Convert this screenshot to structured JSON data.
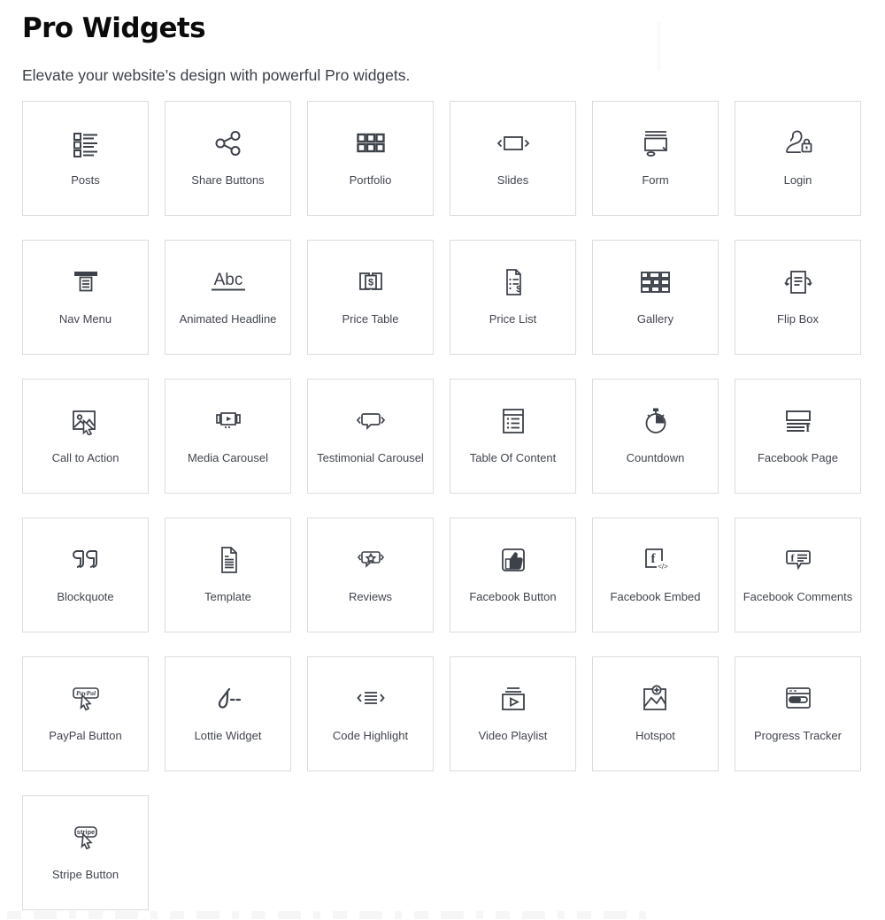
{
  "header": {
    "title": "Pro Widgets",
    "subtitle": "Elevate your website’s design with powerful Pro widgets."
  },
  "colors": {
    "title": "#0b0b0b",
    "subtitle": "#3b3f47",
    "card_border": "#dcdcde",
    "card_bg": "#ffffff",
    "label": "#41454e",
    "icon_stroke": "#3d4149",
    "page_bg": "#ffffff"
  },
  "grid": {
    "columns": 6,
    "rows": 6,
    "total_widgets": 31,
    "widgets": [
      {
        "label": "Posts",
        "icon": "posts-list-icon"
      },
      {
        "label": "Share Buttons",
        "icon": "share-network-icon"
      },
      {
        "label": "Portfolio",
        "icon": "grid-squares-icon"
      },
      {
        "label": "Slides",
        "icon": "slides-arrows-icon"
      },
      {
        "label": "Form",
        "icon": "form-monitor-icon"
      },
      {
        "label": "Login",
        "icon": "user-lock-icon"
      },
      {
        "label": "Nav Menu",
        "icon": "nav-menu-icon"
      },
      {
        "label": "Animated Headline",
        "icon": "abc-underline-icon"
      },
      {
        "label": "Price Table",
        "icon": "price-table-dollar-icon"
      },
      {
        "label": "Price List",
        "icon": "price-list-document-icon"
      },
      {
        "label": "Gallery",
        "icon": "gallery-bricks-icon"
      },
      {
        "label": "Flip Box",
        "icon": "flip-box-icon"
      },
      {
        "label": "Call to Action",
        "icon": "image-cursor-icon"
      },
      {
        "label": "Media Carousel",
        "icon": "media-carousel-icon"
      },
      {
        "label": "Testimonial Carousel",
        "icon": "speech-bubble-arrows-icon"
      },
      {
        "label": "Table Of Content",
        "icon": "table-of-content-icon"
      },
      {
        "label": "Countdown",
        "icon": "stopwatch-icon"
      },
      {
        "label": "Facebook Page",
        "icon": "facebook-page-icon"
      },
      {
        "label": "Blockquote",
        "icon": "quote-marks-icon"
      },
      {
        "label": "Template",
        "icon": "template-document-icon"
      },
      {
        "label": "Reviews",
        "icon": "review-star-bubble-icon"
      },
      {
        "label": "Facebook Button",
        "icon": "thumbs-up-icon"
      },
      {
        "label": "Facebook Embed",
        "icon": "facebook-code-icon"
      },
      {
        "label": "Facebook Comments",
        "icon": "facebook-comment-bubble-icon"
      },
      {
        "label": "PayPal Button",
        "icon": "paypal-button-cursor-icon"
      },
      {
        "label": "Lottie Widget",
        "icon": "lottie-icon"
      },
      {
        "label": "Code Highlight",
        "icon": "code-lines-icon"
      },
      {
        "label": "Video Playlist",
        "icon": "video-playlist-icon"
      },
      {
        "label": "Hotspot",
        "icon": "hotspot-image-plus-icon"
      },
      {
        "label": "Progress Tracker",
        "icon": "progress-tracker-icon"
      },
      {
        "label": "Stripe Button",
        "icon": "stripe-button-cursor-icon"
      }
    ]
  },
  "icon_text": {
    "abc": "Abc",
    "dollar": "$",
    "facebook_f": "f",
    "code_tag": "</>",
    "paypal": "PayPal",
    "stripe": "stripe"
  }
}
